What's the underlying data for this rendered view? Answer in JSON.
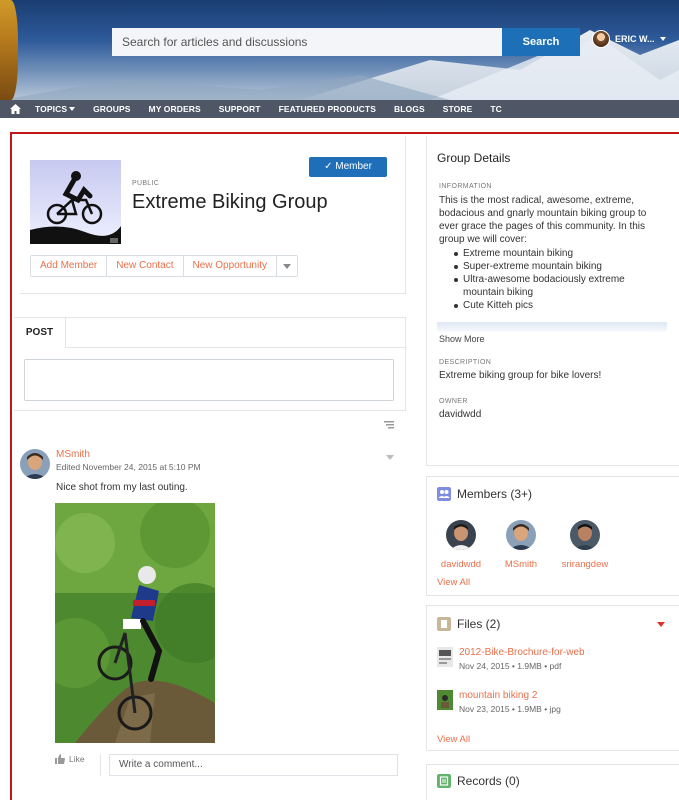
{
  "header": {
    "search_placeholder": "Search for articles and discussions",
    "search_button": "Search",
    "user_name": "ERIC W..."
  },
  "nav": {
    "items": [
      "TOPICS",
      "GROUPS",
      "MY ORDERS",
      "SUPPORT",
      "FEATURED PRODUCTS",
      "BLOGS",
      "STORE",
      "TC"
    ]
  },
  "group": {
    "visibility": "PUBLIC",
    "title": "Extreme Biking Group",
    "member_button": "Member",
    "actions": [
      "Add Member",
      "New Contact",
      "New Opportunity"
    ]
  },
  "post": {
    "tab": "POST"
  },
  "feed": {
    "author": "MSmith",
    "meta": "Edited November 24, 2015 at 5:10 PM",
    "text": "Nice shot from my last outing.",
    "like": "Like",
    "comment_placeholder": "Write a comment..."
  },
  "details": {
    "title": "Group Details",
    "info_label": "INFORMATION",
    "info_text": "This is the most radical, awesome, extreme, bodacious and gnarly mountain biking group to ever grace the pages of this community. In this group we will cover:",
    "info_list": [
      "Extreme mountain biking",
      "Super-extreme mountain biking",
      "Ultra-awesome bodaciously extreme mountain biking",
      "Cute Kitteh pics"
    ],
    "show_more": "Show More",
    "description_label": "DESCRIPTION",
    "description": "Extreme biking group for bike lovers!",
    "owner_label": "OWNER",
    "owner": "davidwdd"
  },
  "members": {
    "title": "Members (3+)",
    "list": [
      "davidwdd",
      "MSmith",
      "srirangdew"
    ],
    "view_all": "View All"
  },
  "files": {
    "title": "Files (2)",
    "list": [
      {
        "name": "2012-Bike-Brochure-for-web",
        "meta": "Nov 24, 2015 • 1.9MB • pdf"
      },
      {
        "name": "mountain biking 2",
        "meta": "Nov 23, 2015 • 1.9MB • jpg"
      }
    ],
    "view_all": "View All"
  },
  "records": {
    "title": "Records (0)"
  },
  "colors": {
    "accent_link": "#e8704a",
    "brand_blue": "#1f6fb8",
    "frame_red": "#c2161b"
  }
}
